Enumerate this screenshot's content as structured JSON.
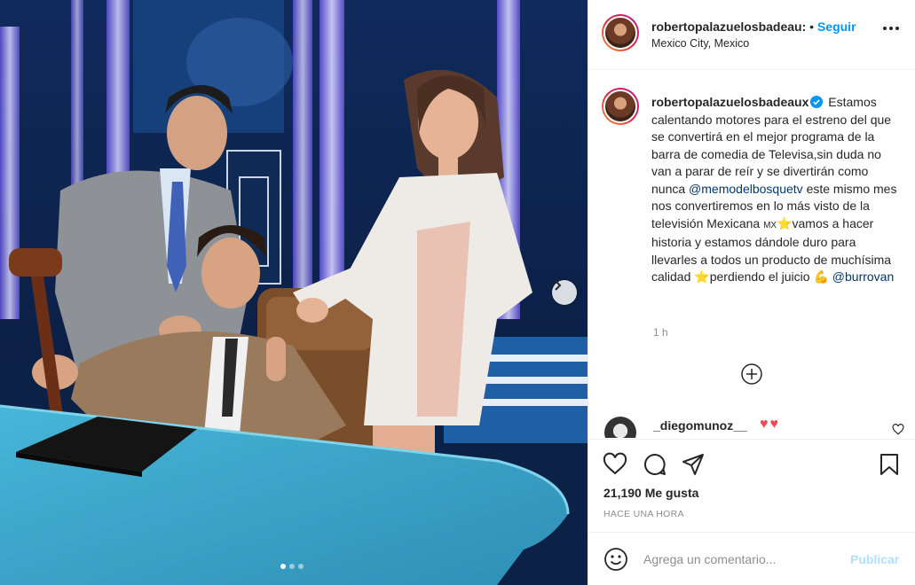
{
  "header": {
    "username": "robertopalazuelosbadeau:",
    "separator": "•",
    "follow_label": "Seguir",
    "location": "Mexico City, Mexico"
  },
  "caption": {
    "username": "robertopalazuelosbadeaux",
    "text_1": "Estamos calentando motores para el estreno del que se convertirá en el mejor programa de la barra de comedia de Televisa,sin duda no van a parar de reír y se divertirán como nunca",
    "mention_1": "@memodelbosquetv",
    "text_2": "este mismo mes nos convertiremos en lo más visto de la televisión Mexicana",
    "flag_text": "MX",
    "star_1": "⭐",
    "text_3": "vamos a hacer historia y estamos dándole duro para llevarles a todos un producto de muchísima calidad",
    "star_2": "⭐",
    "text_4": "perdiendo el juicio",
    "flex_emoji": "💪",
    "mention_2": "@burrovan",
    "time": "1 h"
  },
  "comment": {
    "username": "_diegomunoz__",
    "text": "♥♥"
  },
  "actions": {
    "likes": "21,190 Me gusta",
    "posted": "HACE UNA HORA"
  },
  "add_comment": {
    "placeholder": "Agrega un comentario...",
    "publish_label": "Publicar"
  },
  "carousel": {
    "current": 1,
    "total": 3
  },
  "colors": {
    "link_blue": "#0095f6",
    "mention": "#00376b",
    "heart": "#ed4956",
    "muted": "#8e8e8e"
  }
}
